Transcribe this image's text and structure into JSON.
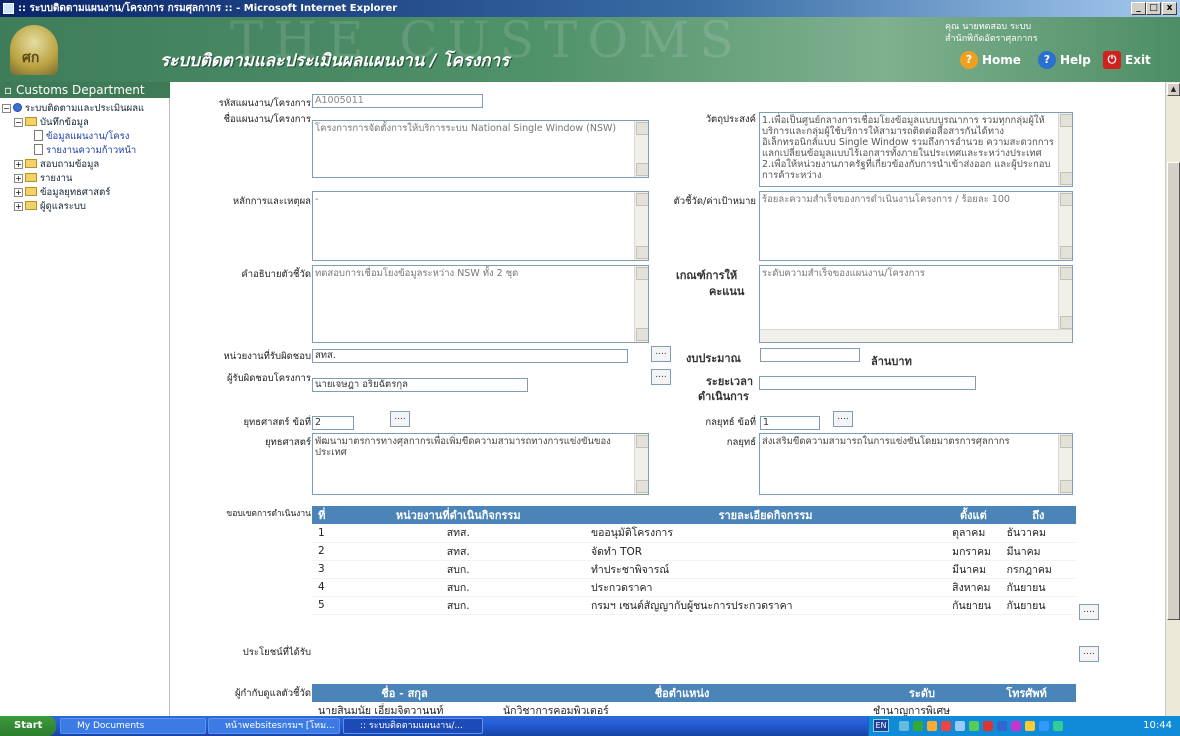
{
  "window": {
    "title": ":: ระบบติดตามแผนงาน/โครงการ กรมศุลกากร :: - Microsoft Internet Explorer",
    "min": "_",
    "max": "□",
    "close": "x"
  },
  "banner": {
    "watermark": "THE CUSTOMS",
    "logo_text": "ศก",
    "app_title": "ระบบติดตามและประเมินผลแผนงาน / โครงการ",
    "user_line1": "คุณ นายทดสอบ ระบบ",
    "user_line2": "สำนักพิกัดอัตราศุลกากร",
    "nav": {
      "home": "Home",
      "help": "Help",
      "exit": "Exit",
      "home_icon": "?",
      "help_icon": "?",
      "exit_icon": "⏻"
    }
  },
  "sidebar": {
    "title": "Customs Department",
    "items": [
      {
        "label": "ระบบติดตามและประเมินผลแ"
      },
      {
        "label": "บันทึกข้อมูล"
      },
      {
        "label": "ข้อมูลแผนงาน/โครง"
      },
      {
        "label": "รายงานความก้าวหน้า"
      },
      {
        "label": "สอบถามข้อมูล"
      },
      {
        "label": "รายงาน"
      },
      {
        "label": "ข้อมูลยุทธศาสตร์"
      },
      {
        "label": "ผู้ดูแลระบบ"
      }
    ]
  },
  "form": {
    "project_code_label": "รหัสแผนงาน/โครงการ",
    "project_code": "A1005011",
    "project_name_label": "ชื่อแผนงาน/โครงการ",
    "project_name": "โครงการการจัดตั้งการให้บริการระบบ National Single Window (NSW)",
    "objective_label": "วัตถุประสงค์",
    "objective": "1.เพื่อเป็นศูนย์กลางการเชื่อมโยงข้อมูลแบบบูรณาการ รวมทุกกลุ่มผู้ให้บริการและกลุ่มผู้ใช้บริการให้สามารถติดต่อสื่อสารกันได้ทางอิเล็กทรอนิกส์แบบ Single Window รวมถึงการอำนวย ความสะดวกการแลกเปลี่ยนข้อมูลแบบไร้เอกสารทั้งภายในประเทศและระหว่างประเทศ 2.เพื่อให้หน่วยงานภาครัฐที่เกี่ยวข้องกับการนำเข้าส่งออก และผู้ประกอบการค้าระหว่าง",
    "principle_label": "หลักการและเหตุผล",
    "principle": "-",
    "indicator_label": "ตัวชี้วัด/ค่าเป้าหมาย",
    "indicator": "ร้อยละความสำเร็จของการดำเนินงานโครงการ / ร้อยละ 100",
    "indicator_desc_label": "คำอธิบายตัวชี้วัด",
    "indicator_desc": "ทดสอบการเชื่อมโยงข้อมูลระหว่าง NSW ทั้ง 2 ชุด",
    "criteria_label_1": "เกณฑ์การให้",
    "criteria_label_2": "คะแนน",
    "criteria": "ระดับความสำเร็จของแผนงาน/โครงการ",
    "responsible_unit_label": "หน่วยงานที่รับผิดชอบ",
    "responsible_unit": "สทส.",
    "budget_label": "งบประมาณ",
    "budget": "",
    "budget_unit": "ล้านบาท",
    "project_owner_label": "ผู้รับผิดชอบโครงการ",
    "project_owner": "นายเจษฎา อริยฉัตรกุล",
    "duration_label_1": "ระยะเวลา",
    "duration_label_2": "ดำเนินการ",
    "duration": "",
    "strategy_no_label": "ยุทธศาสตร์ ข้อที่",
    "strategy_no": "2",
    "tactic_no_label": "กลยุทธ์ ข้อที่",
    "tactic_no": "1",
    "strategy_label": "ยุทธศาสตร์",
    "strategy": "พัฒนามาตรการทางศุลกากรเพื่อเพิ่มขีดความสามารถทางการแข่งขันของประเทศ",
    "tactic_label": "กลยุทธ์",
    "tactic": "ส่งเสริมขีดความสามารถในการแข่งขันโดยมาตรการศุลกากร",
    "scope_label": "ขอบเขตการดำเนินงาน",
    "benefit_label": "ประโยชน์ที่ได้รับ",
    "supervisor_label": "ผู้กำกับดูแลตัวชี้วัด",
    "dots": "...."
  },
  "scope_table": {
    "headers": [
      "ที่",
      "หน่วยงานที่ดำเนินกิจกรรม",
      "รายละเอียดกิจกรรม",
      "ตั้งแต่",
      "ถึง"
    ],
    "rows": [
      [
        "1",
        "สทส.",
        "ขออนุมัติโครงการ",
        "ตุลาคม",
        "ธันวาคม"
      ],
      [
        "2",
        "สทส.",
        "จัดทำ TOR",
        "มกราคม",
        "มีนาคม"
      ],
      [
        "3",
        "สบก.",
        "ทำประชาพิจารณ์",
        "มีนาคม",
        "กรกฎาคม"
      ],
      [
        "4",
        "สบก.",
        "ประกวดราคา",
        "สิงหาคม",
        "กันยายน"
      ],
      [
        "5",
        "สบก.",
        "กรมฯ เซนต์สัญญากับผู้ชนะการประกวดราคา",
        "กันยายน",
        "กันยายน"
      ]
    ]
  },
  "supervisor_table": {
    "headers": [
      "ชื่อ - สกุล",
      "ชื่อตำแหน่ง",
      "ระดับ",
      "โทรศัพท์"
    ],
    "rows": [
      [
        "นายสินมนัย เอี่ยมจิตวานนท์",
        "นักวิชาการคอมพิวเตอร์",
        "ชำนาญการพิเศษ",
        ""
      ]
    ]
  },
  "taskbar": {
    "start": "Start",
    "tasks": [
      "My Documents",
      "หน้าwebsitesกรมฯ [โหม...",
      ":: ระบบติดตามแผนงาน/..."
    ],
    "lang": "EN",
    "clock": "10:44"
  },
  "colors": {
    "banner": "#4f9169",
    "header": "#4b84b8",
    "sidebar_title": "#3e7a55"
  }
}
